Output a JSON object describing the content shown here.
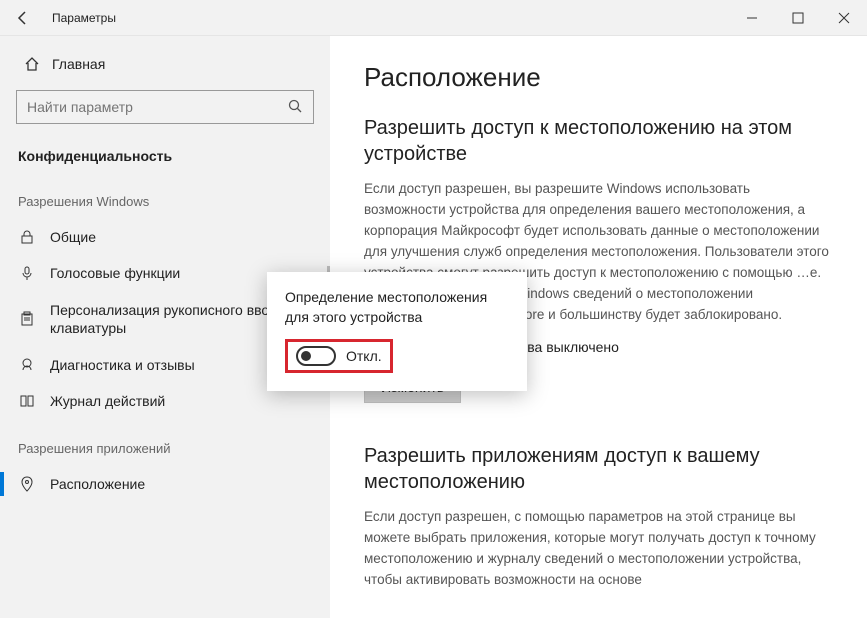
{
  "window": {
    "title": "Параметры"
  },
  "sidebar": {
    "home": "Главная",
    "search_placeholder": "Найти параметр",
    "section": "Конфиденциальность",
    "group_windows": "Разрешения Windows",
    "group_apps": "Разрешения приложений",
    "items_windows": [
      {
        "label": "Общие"
      },
      {
        "label": "Голосовые функции"
      },
      {
        "label": "Персонализация рукописного ввода с клавиатуры"
      },
      {
        "label": "Диагностика и отзывы"
      },
      {
        "label": "Журнал действий"
      }
    ],
    "items_apps": [
      {
        "label": "Расположение"
      }
    ]
  },
  "content": {
    "page_title": "Расположение",
    "heading1": "Разрешить доступ к местоположению на этом устройстве",
    "para1": "Если доступ разрешен, вы разрешите Windows использовать возможности устройства для определения вашего местоположения, а корпорация Майкрософт будет использовать данные о местоположении для улучшения служб определения местоположения. Пользователи этого устройства смогут разрешить доступ к местоположению с помощью …е. Если доступ запрещен, Windows сведений о местоположении приложениям Microsoft Store и большинству будет заблокировано.",
    "status_line": "…ния для этого устройства выключено",
    "change_btn": "Изменить",
    "heading2": "Разрешить приложениям доступ к вашему местоположению",
    "para2": "Если доступ разрешен, с помощью параметров на этой странице вы можете выбрать приложения, которые могут получать доступ к точному местоположению и журналу сведений о местоположении устройства, чтобы активировать возможности на основе"
  },
  "popup": {
    "title": "Определение местоположения для этого устройства",
    "toggle_state": "Откл."
  }
}
